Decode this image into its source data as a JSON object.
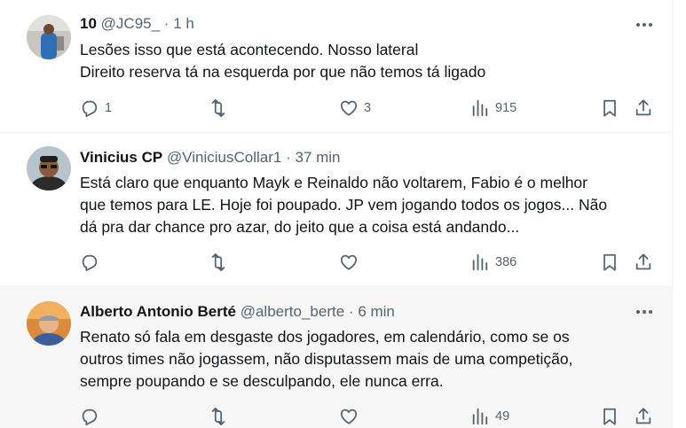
{
  "tweets": [
    {
      "name": "10",
      "handle": "@JC95_",
      "dot": "·",
      "time": "1 h",
      "text": "Lesões isso que está acontecendo. Nosso lateral\nDireito reserva tá na esquerda por que não temos tá ligado",
      "replies": "1",
      "retweets": "",
      "likes": "3",
      "views": "915"
    },
    {
      "name": "Vinicius CP",
      "handle": "@ViniciusCollar1",
      "dot": "·",
      "time": "37 min",
      "text": "Está claro que enquanto Mayk e Reinaldo não voltarem, Fabio é o melhor\nque temos para LE. Hoje foi poupado. JP vem jogando todos os jogos... Não\ndá pra dar chance pro azar, do jeito que a coisa está andando...",
      "replies": "",
      "retweets": "",
      "likes": "",
      "views": "386"
    },
    {
      "name": "Alberto Antonio Berté",
      "handle": "@alberto_berte",
      "dot": "·",
      "time": "6 min",
      "text": "Renato só fala em desgaste dos jogadores, em calendário, como se os\noutros times não jogassem, não disputassem mais de uma competição,\nsempre poupando e se desculpando, ele nunca erra.",
      "replies": "",
      "retweets": "",
      "likes": "",
      "views": "49"
    }
  ],
  "colors": {
    "text": "#0f1419",
    "secondary": "#536471",
    "divider": "#eff3f4"
  },
  "icons": [
    "reply-icon",
    "retweet-icon",
    "like-icon",
    "views-icon",
    "bookmark-icon",
    "share-icon",
    "more-icon"
  ]
}
